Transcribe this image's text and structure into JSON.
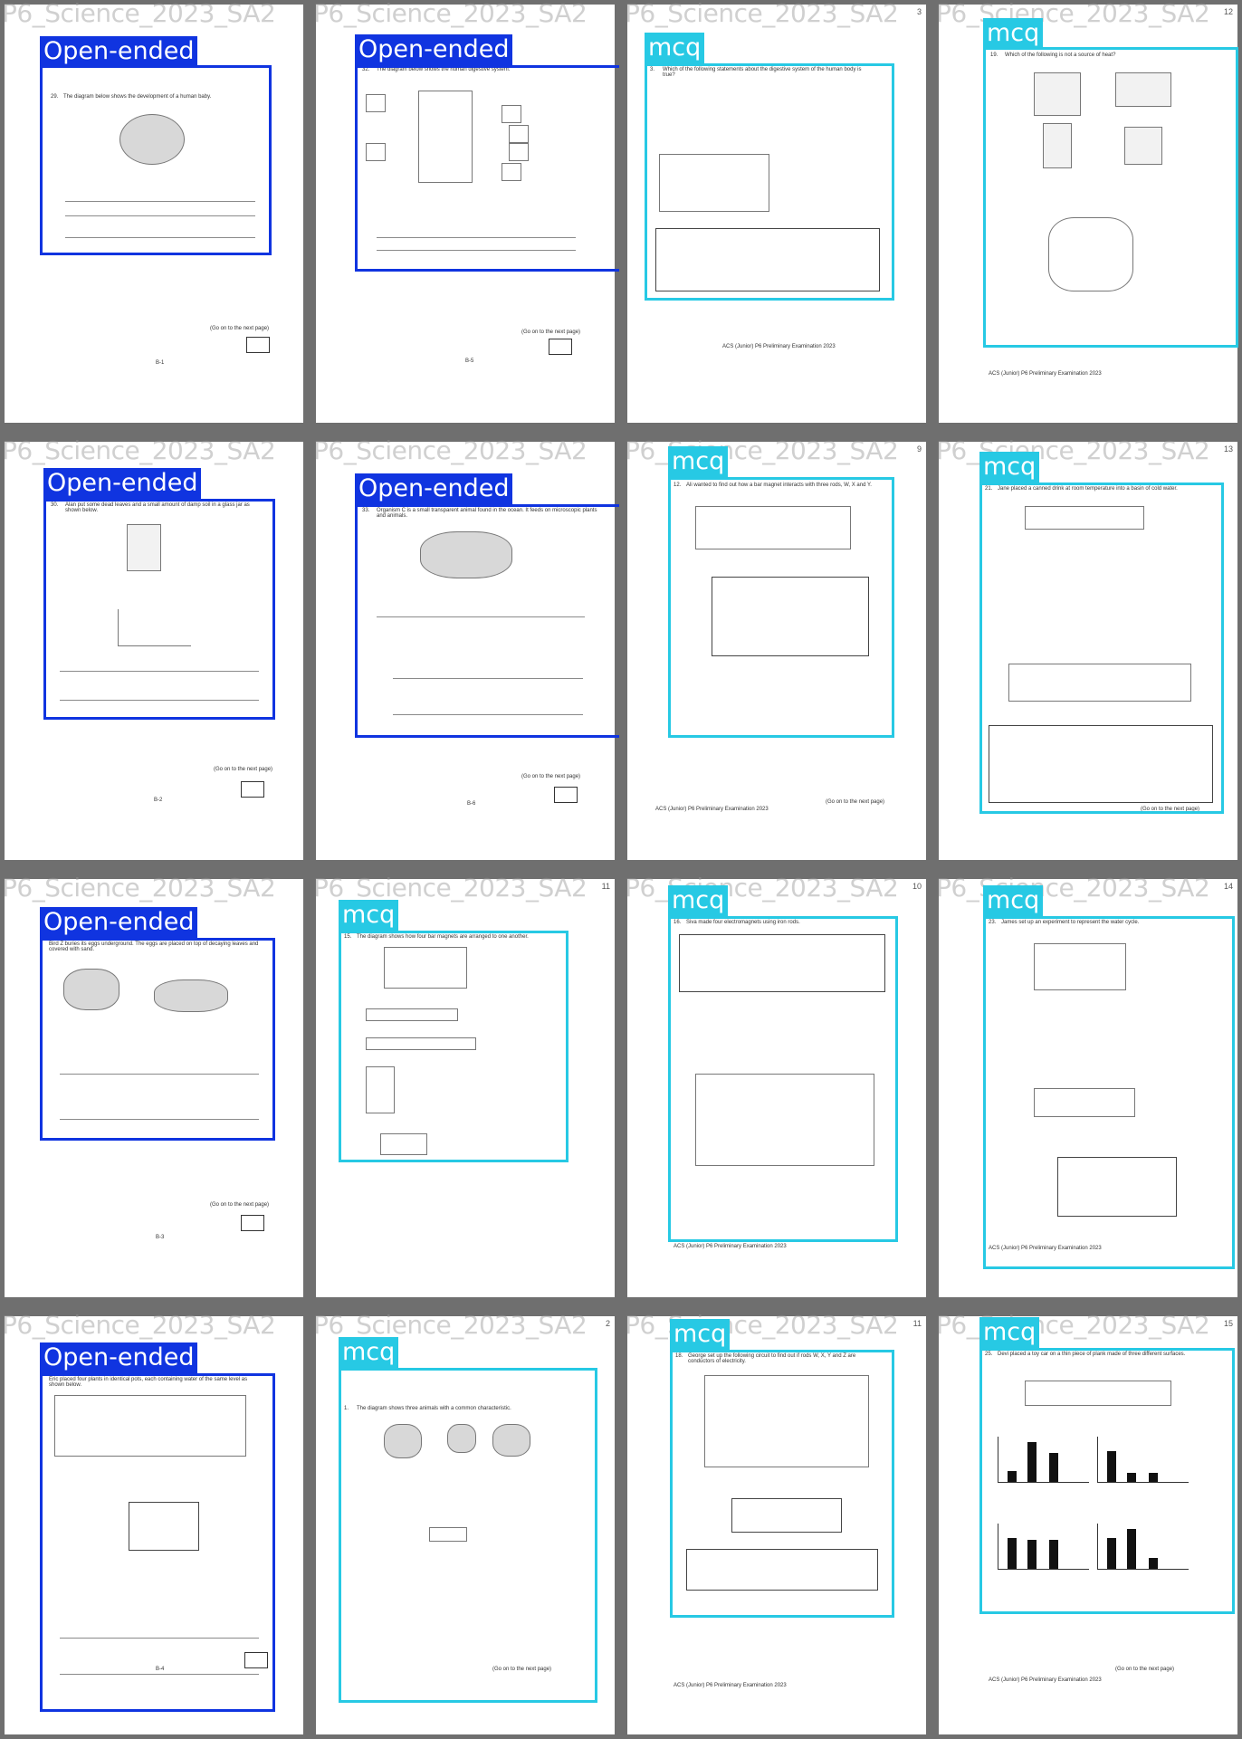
{
  "file_prefix": "P6_Science_2023_SA2",
  "footer": {
    "next_page": "(Go on to the next page)",
    "school": "ACS (Junior) P6 Preliminary Examination 2023"
  },
  "tiles": [
    {
      "id": 1,
      "type": "oe",
      "label": "Open-ended",
      "page": "B-1",
      "q": "29.",
      "title": "The diagram below shows the development of a human baby."
    },
    {
      "id": 2,
      "type": "oe",
      "label": "Open-ended",
      "page": "B-5",
      "q": "32.",
      "title": "The diagram below shows the human digestive system."
    },
    {
      "id": 3,
      "type": "mcq",
      "label": "mcq",
      "page": "3",
      "q": "3.",
      "title": "Which of the following statements about the digestive system of the human body is true?"
    },
    {
      "id": 4,
      "type": "mcq",
      "label": "mcq",
      "page": "12",
      "q": "19.",
      "title": "Which of the following is not a source of heat?"
    },
    {
      "id": 5,
      "type": "oe",
      "label": "Open-ended",
      "page": "B-2",
      "q": "30.",
      "title": "Alan put some dead leaves and a small amount of damp soil in a glass jar as shown below."
    },
    {
      "id": 6,
      "type": "oe",
      "label": "Open-ended",
      "page": "B-6",
      "q": "33.",
      "title": "Organism C is a small transparent animal found in the ocean. It feeds on microscopic plants and animals."
    },
    {
      "id": 7,
      "type": "mcq",
      "label": "mcq",
      "page": "9",
      "q": "12.",
      "title": "Ali wanted to find out how a bar magnet interacts with three rods, W, X and Y."
    },
    {
      "id": 8,
      "type": "mcq",
      "label": "mcq",
      "page": "13",
      "q": "21.",
      "title": "Jane placed a canned drink at room temperature into a basin of cold water."
    },
    {
      "id": 9,
      "type": "oe",
      "label": "Open-ended",
      "page": "B-3",
      "q": "31.",
      "title": "Bird Z buries its eggs underground. The eggs are placed on top of decaying leaves and covered with sand."
    },
    {
      "id": 10,
      "type": "mcq",
      "label": "mcq",
      "page": "11",
      "q": "15.",
      "title": "The diagram shows how four bar magnets are arranged to one another."
    },
    {
      "id": 11,
      "type": "mcq",
      "label": "mcq",
      "page": "10",
      "q": "16.",
      "title": "Siva made four electromagnets using iron rods."
    },
    {
      "id": 12,
      "type": "mcq",
      "label": "mcq",
      "page": "14",
      "q": "23.",
      "title": "James set up an experiment to represent the water cycle."
    },
    {
      "id": 13,
      "type": "oe",
      "label": "Open-ended",
      "page": "B-4",
      "q": "31.",
      "title": "Eric placed four plants in identical pots, each containing water of the same level as shown below."
    },
    {
      "id": 14,
      "type": "mcq",
      "label": "mcq",
      "page": "2",
      "q": "1.",
      "title": "The diagram shows three animals with a common characteristic."
    },
    {
      "id": 15,
      "type": "mcq",
      "label": "mcq",
      "page": "11",
      "q": "18.",
      "title": "George set up the following circuit to find out if rods W, X, Y and Z are conductors of electricity."
    },
    {
      "id": 16,
      "type": "mcq",
      "label": "mcq",
      "page": "15",
      "q": "25.",
      "title": "Devi placed a toy car on a thin piece of plank made of three different surfaces."
    }
  ]
}
